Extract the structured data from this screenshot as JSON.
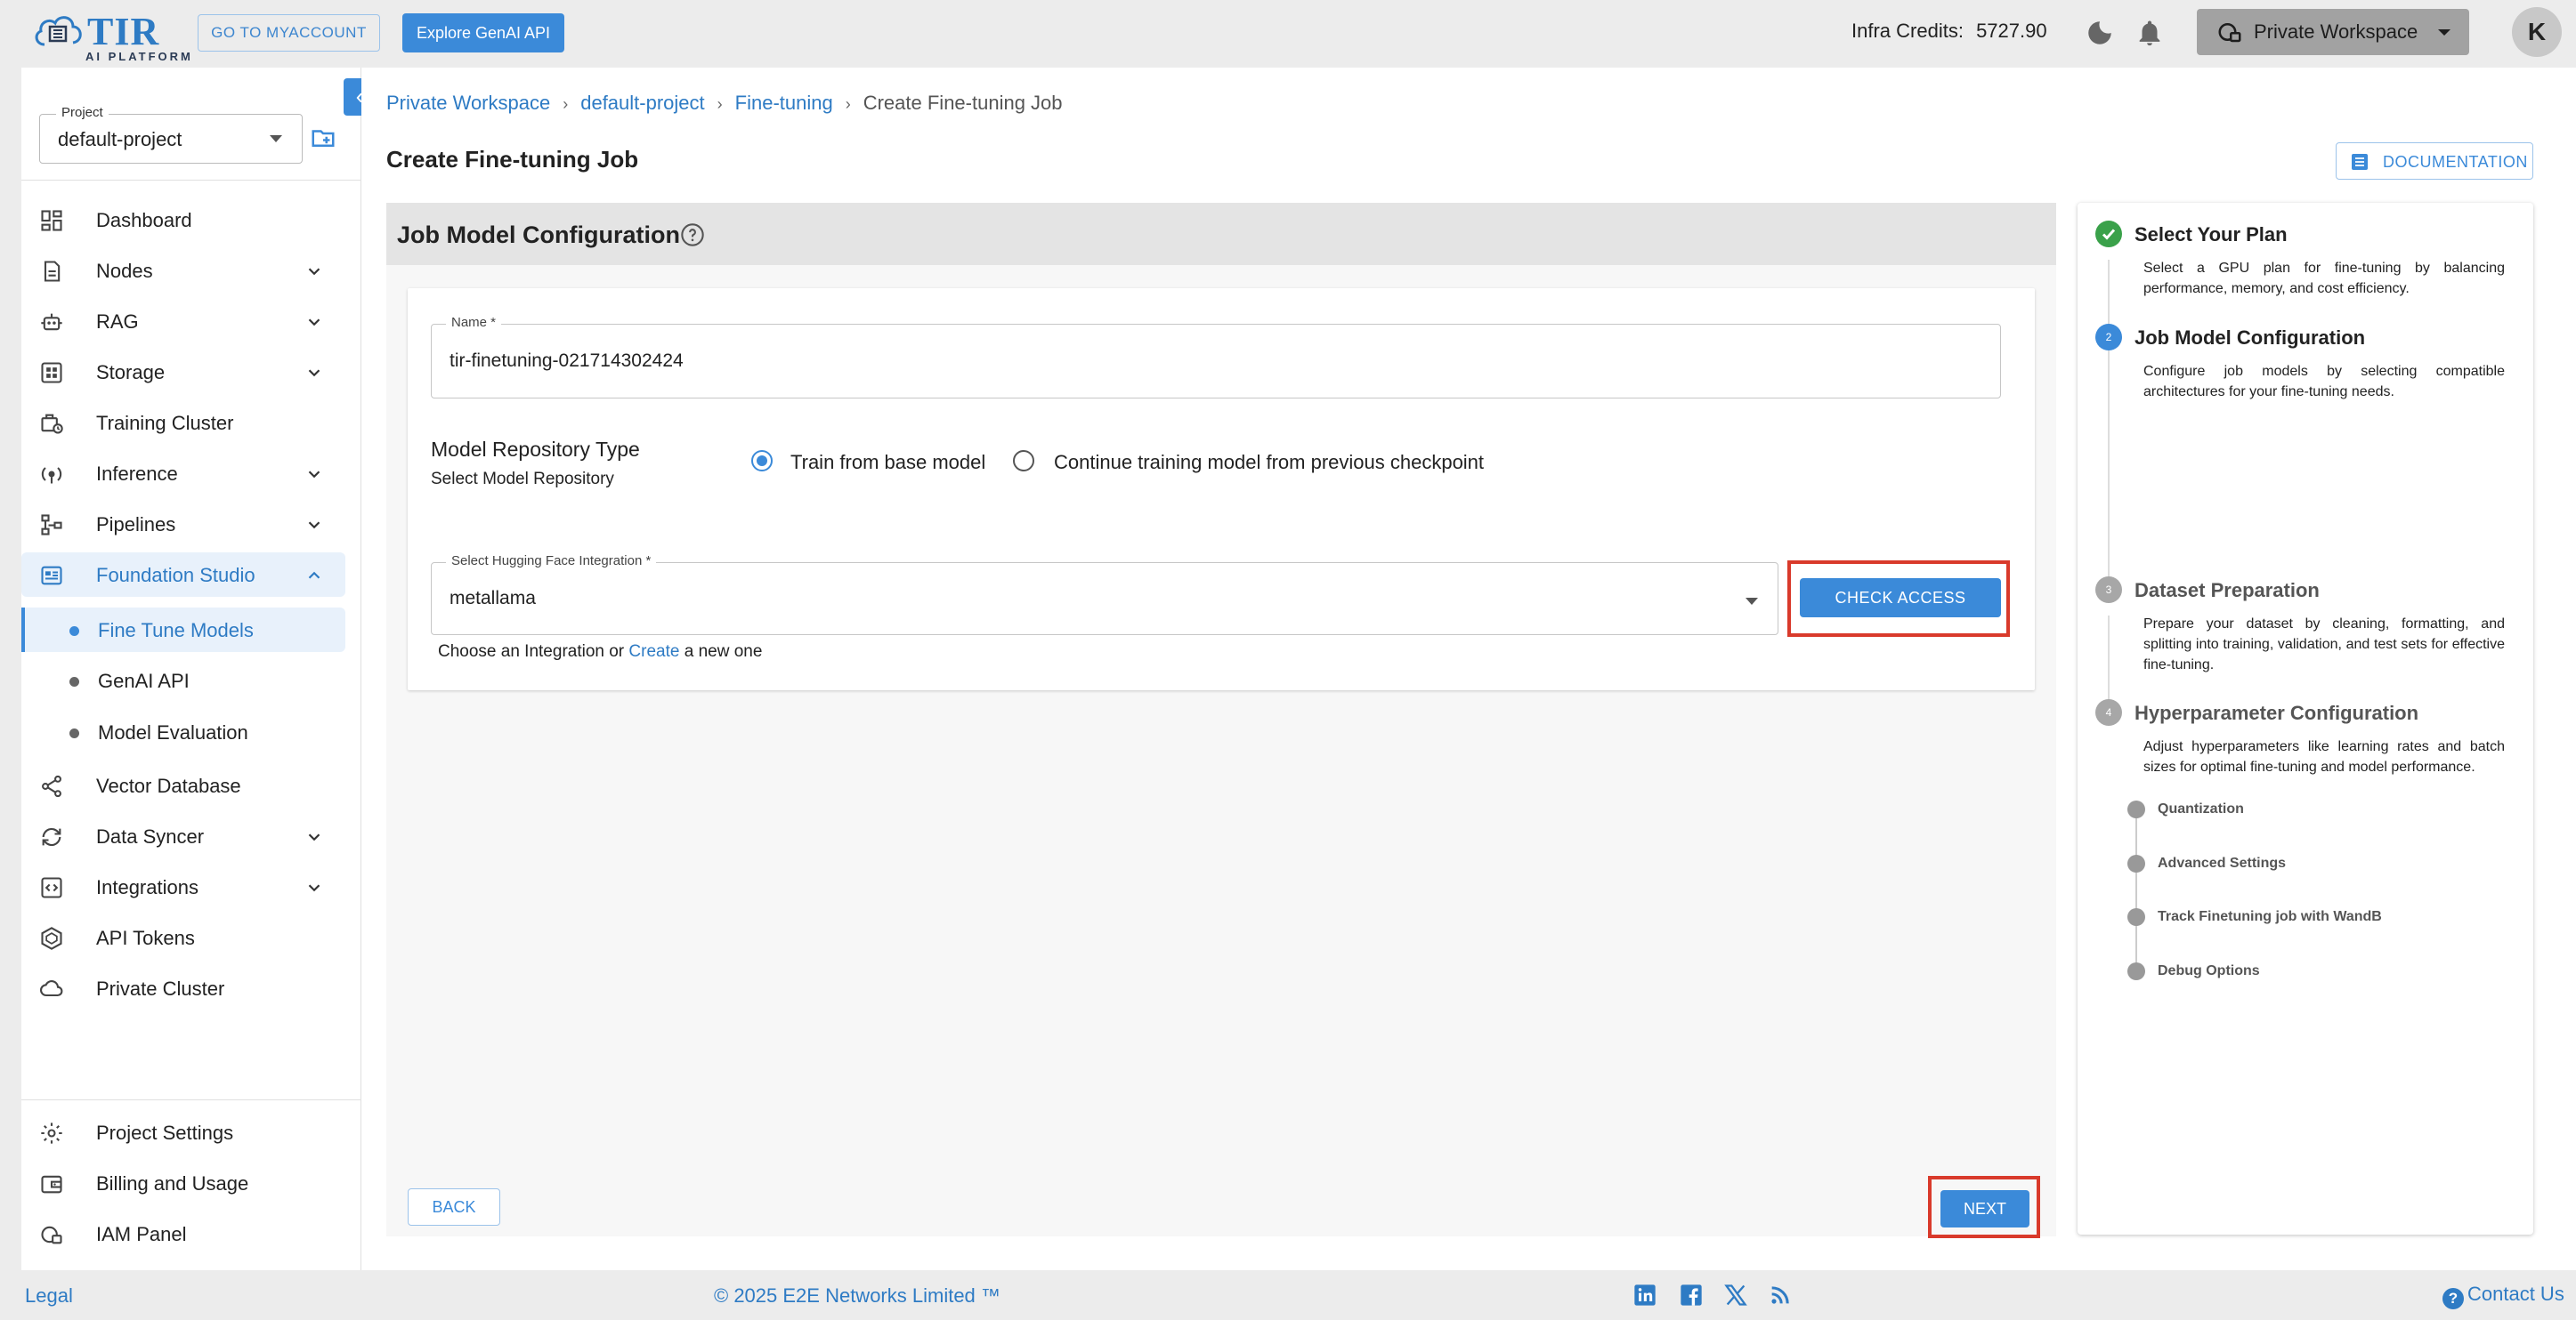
{
  "header": {
    "logo_text": "TIR",
    "logo_sub": "AI PLATFORM",
    "myaccount_label": "GO TO MYACCOUNT",
    "genai_label": "Explore GenAI API",
    "credits_label": "Infra Credits:",
    "credits_value": "5727.90",
    "workspace_label": "Private Workspace",
    "avatar_initial": "K"
  },
  "sidebar": {
    "project_legend": "Project",
    "project_value": "default-project",
    "items": [
      {
        "label": "Dashboard",
        "icon": "dashboard-icon"
      },
      {
        "label": "Nodes",
        "icon": "nodes-icon"
      },
      {
        "label": "RAG",
        "icon": "rag-icon"
      },
      {
        "label": "Storage",
        "icon": "storage-icon"
      },
      {
        "label": "Training Cluster",
        "icon": "training-cluster-icon"
      },
      {
        "label": "Inference",
        "icon": "inference-icon"
      },
      {
        "label": "Pipelines",
        "icon": "pipelines-icon"
      },
      {
        "label": "Foundation Studio",
        "icon": "foundation-studio-icon"
      },
      {
        "label": "Vector Database",
        "icon": "vector-database-icon"
      },
      {
        "label": "Data Syncer",
        "icon": "data-syncer-icon"
      },
      {
        "label": "Integrations",
        "icon": "integrations-icon"
      },
      {
        "label": "API Tokens",
        "icon": "api-tokens-icon"
      },
      {
        "label": "Private Cluster",
        "icon": "private-cluster-icon"
      }
    ],
    "sub_items": [
      {
        "label": "Fine Tune Models"
      },
      {
        "label": "GenAI API"
      },
      {
        "label": "Model Evaluation"
      }
    ],
    "bottom_items": [
      {
        "label": "Project Settings",
        "icon": "settings-icon"
      },
      {
        "label": "Billing and Usage",
        "icon": "billing-icon"
      },
      {
        "label": "IAM Panel",
        "icon": "iam-icon"
      }
    ]
  },
  "breadcrumb": {
    "items": [
      "Private Workspace",
      "default-project",
      "Fine-tuning"
    ],
    "current": "Create Fine-tuning Job"
  },
  "page": {
    "title": "Create Fine-tuning Job",
    "documentation_label": "DOCUMENTATION"
  },
  "form": {
    "section_title": "Job Model Configuration",
    "name_legend": "Name *",
    "name_value": "tir-finetuning-021714302424",
    "repo_title": "Model Repository Type",
    "repo_sub": "Select Model Repository",
    "radio_options": [
      "Train from base model",
      "Continue training model from previous checkpoint"
    ],
    "radio_selected": "Train from base model",
    "hf_legend": "Select Hugging Face Integration *",
    "hf_value": "metallama",
    "check_access_label": "CHECK ACCESS",
    "hint_prefix": "Choose an Integration or",
    "hint_link": "Create",
    "hint_suffix": "a new one",
    "back_label": "BACK",
    "next_label": "NEXT"
  },
  "stepper": {
    "steps": [
      {
        "number": "1",
        "title": "Select Your Plan",
        "desc": "Select a GPU plan for fine-tuning by balancing performance, memory, and cost efficiency.",
        "status": "done"
      },
      {
        "number": "2",
        "title": "Job Model Configuration",
        "desc": "Configure job models by selecting compatible architectures for your fine-tuning needs.",
        "status": "active"
      },
      {
        "number": "3",
        "title": "Dataset Preparation",
        "desc": "Prepare your dataset by cleaning, formatting, and splitting into training, validation, and test sets for effective fine-tuning.",
        "status": "todo"
      },
      {
        "number": "4",
        "title": "Hyperparameter Configuration",
        "desc": "Adjust hyperparameters like learning rates and batch sizes for optimal fine-tuning and model performance.",
        "status": "todo"
      }
    ],
    "sub_steps": [
      "Quantization",
      "Advanced Settings",
      "Track Finetuning job with WandB",
      "Debug Options"
    ]
  },
  "footer": {
    "legal": "Legal",
    "copyright": "© 2025 E2E Networks Limited ™",
    "contact": "Contact Us",
    "socials": [
      "linkedin-icon",
      "facebook-icon",
      "x-icon",
      "rss-icon"
    ]
  },
  "colors": {
    "accent": "#3b8ad9",
    "success": "#3aa14a",
    "highlight": "#d93a2b"
  }
}
